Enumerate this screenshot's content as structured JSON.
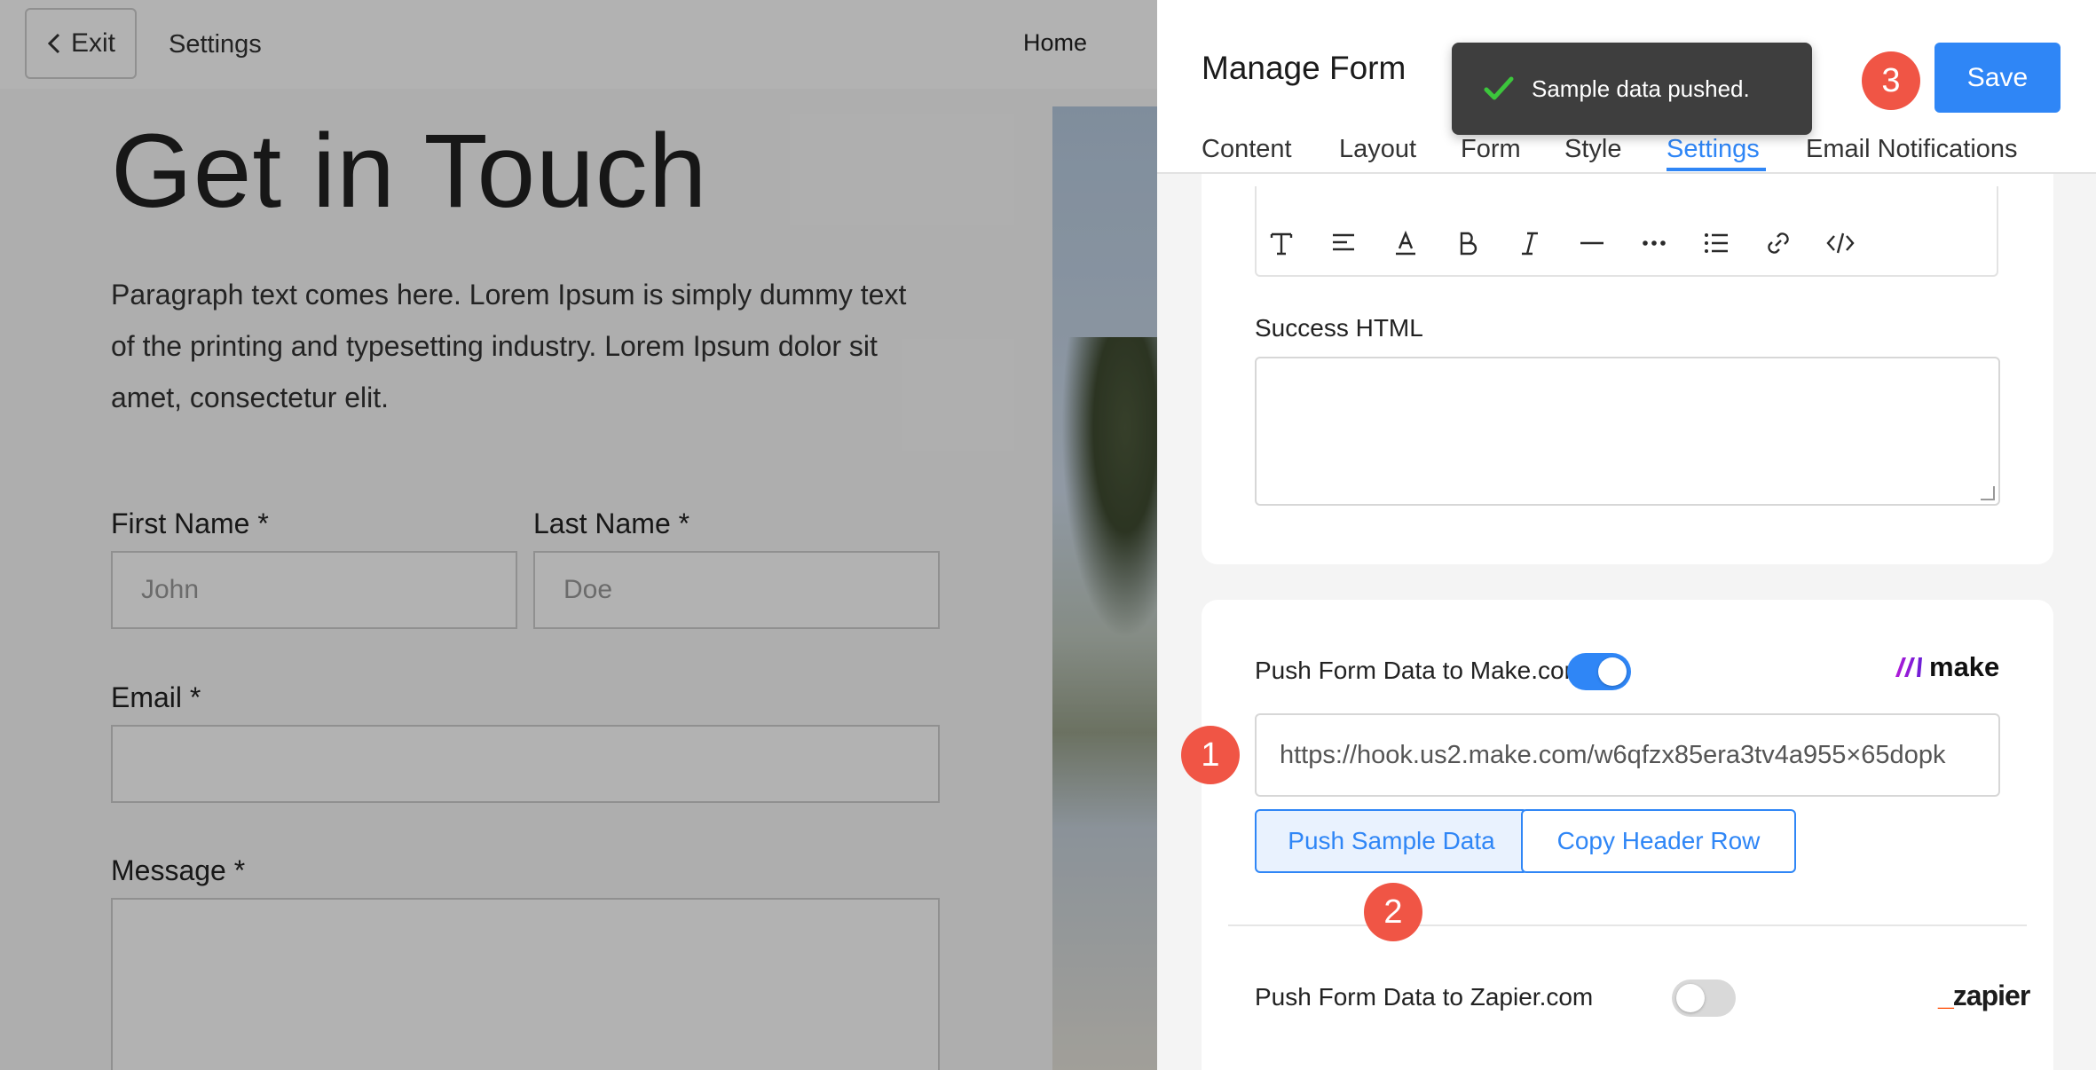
{
  "topbar": {
    "exit_label": "Exit",
    "breadcrumb": "Settings",
    "nav_home": "Home"
  },
  "preview": {
    "title": "Get in Touch",
    "paragraph": "Paragraph text comes here. Lorem Ipsum is simply dummy text of the printing and typesetting industry. Lorem Ipsum dolor sit amet, consectetur elit.",
    "first_name_label": "First Name *",
    "first_name_placeholder": "John",
    "last_name_label": "Last Name *",
    "last_name_placeholder": "Doe",
    "email_label": "Email *",
    "message_label": "Message *"
  },
  "panel": {
    "title": "Manage Form",
    "save_label": "Save",
    "tabs": [
      {
        "label": "Content"
      },
      {
        "label": "Layout"
      },
      {
        "label": "Form"
      },
      {
        "label": "Style"
      },
      {
        "label": "Settings",
        "active": true
      },
      {
        "label": "Email Notifications"
      }
    ],
    "toast": "Sample data pushed.",
    "toolbar_icons": [
      "text-type-icon",
      "align-left-icon",
      "text-color-icon",
      "bold-icon",
      "italic-icon",
      "horizontal-rule-icon",
      "more-icon",
      "list-icon",
      "link-icon",
      "code-icon"
    ],
    "success_html_label": "Success HTML",
    "make": {
      "label": "Push Form Data to Make.com",
      "enabled": true,
      "logo_text": "make",
      "webhook_url": "https://hook.us2.make.com/w6qfzx85era3tv4a955×65dopk",
      "push_sample_label": "Push Sample Data",
      "copy_header_label": "Copy Header Row"
    },
    "zapier": {
      "label": "Push Form Data to Zapier.com",
      "enabled": false,
      "logo_text": "zapier"
    }
  },
  "steps": [
    "1",
    "2",
    "3"
  ],
  "colors": {
    "accent": "#2f86f6",
    "step_badge": "#f05545",
    "toast_bg": "#3e3e3e",
    "toast_check": "#3cc63c"
  }
}
